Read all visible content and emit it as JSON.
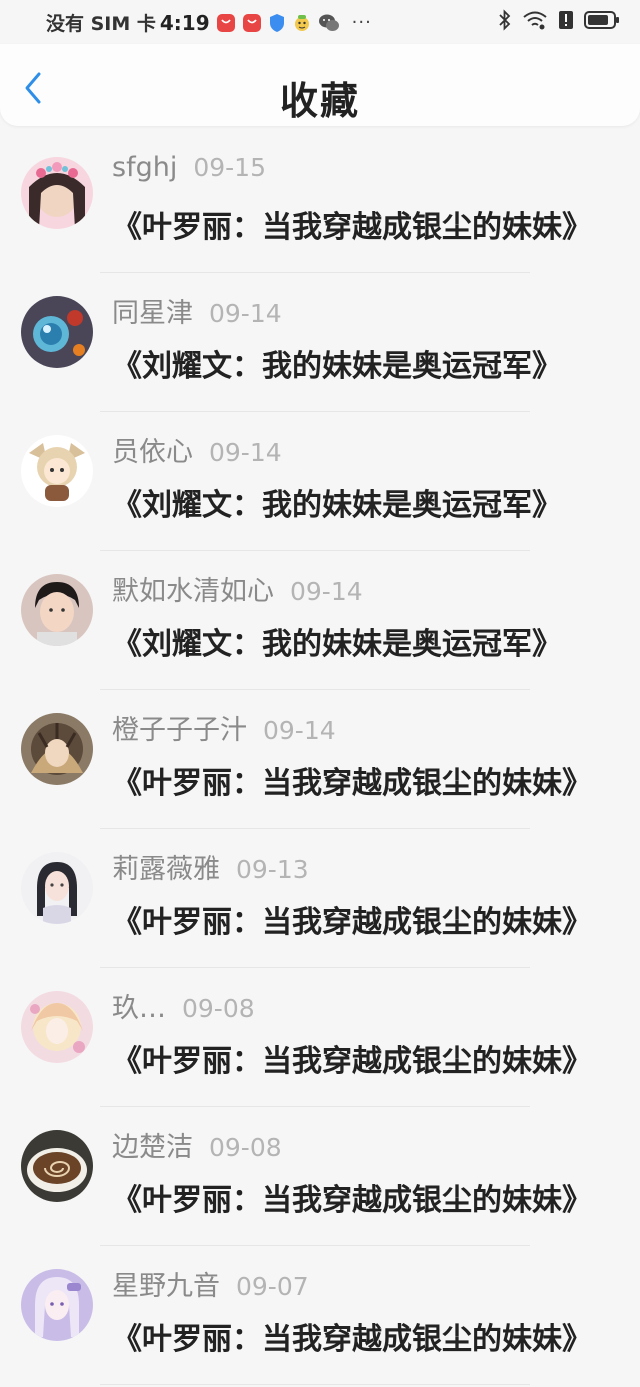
{
  "status_bar": {
    "carrier": "没有 SIM 卡",
    "time": "4:19",
    "overflow": "···",
    "icons": [
      "huawei-store-icon",
      "huawei-store-icon",
      "shield-icon",
      "mascot-icon",
      "wechat-icon",
      "bluetooth-icon",
      "wifi-icon",
      "alert-icon",
      "battery-icon"
    ]
  },
  "header": {
    "title": "收藏",
    "back_icon": "chevron-left-icon"
  },
  "colors": {
    "accent": "#2f8fe8",
    "title": "#222222",
    "meta": "#8a8a8a",
    "date": "#b4b4b4",
    "background": "#f6f6f6"
  },
  "items": [
    {
      "user": "sfghj",
      "date": "09-15",
      "title": "《叶罗丽：当我穿越成银尘的妹妹》"
    },
    {
      "user": "同星津",
      "date": "09-14",
      "title": "《刘耀文：我的妹妹是奥运冠军》"
    },
    {
      "user": "员依心",
      "date": "09-14",
      "title": "《刘耀文：我的妹妹是奥运冠军》"
    },
    {
      "user": "默如水清如心",
      "date": "09-14",
      "title": "《刘耀文：我的妹妹是奥运冠军》"
    },
    {
      "user": "橙子子子汁",
      "date": "09-14",
      "title": "《叶罗丽：当我穿越成银尘的妹妹》"
    },
    {
      "user": "莉露薇雅",
      "date": "09-13",
      "title": "《叶罗丽：当我穿越成银尘的妹妹》"
    },
    {
      "user": "玖…",
      "date": "09-08",
      "title": "《叶罗丽：当我穿越成银尘的妹妹》"
    },
    {
      "user": "边楚洁",
      "date": "09-08",
      "title": "《叶罗丽：当我穿越成银尘的妹妹》"
    },
    {
      "user": "星野九音",
      "date": "09-07",
      "title": "《叶罗丽：当我穿越成银尘的妹妹》"
    }
  ]
}
